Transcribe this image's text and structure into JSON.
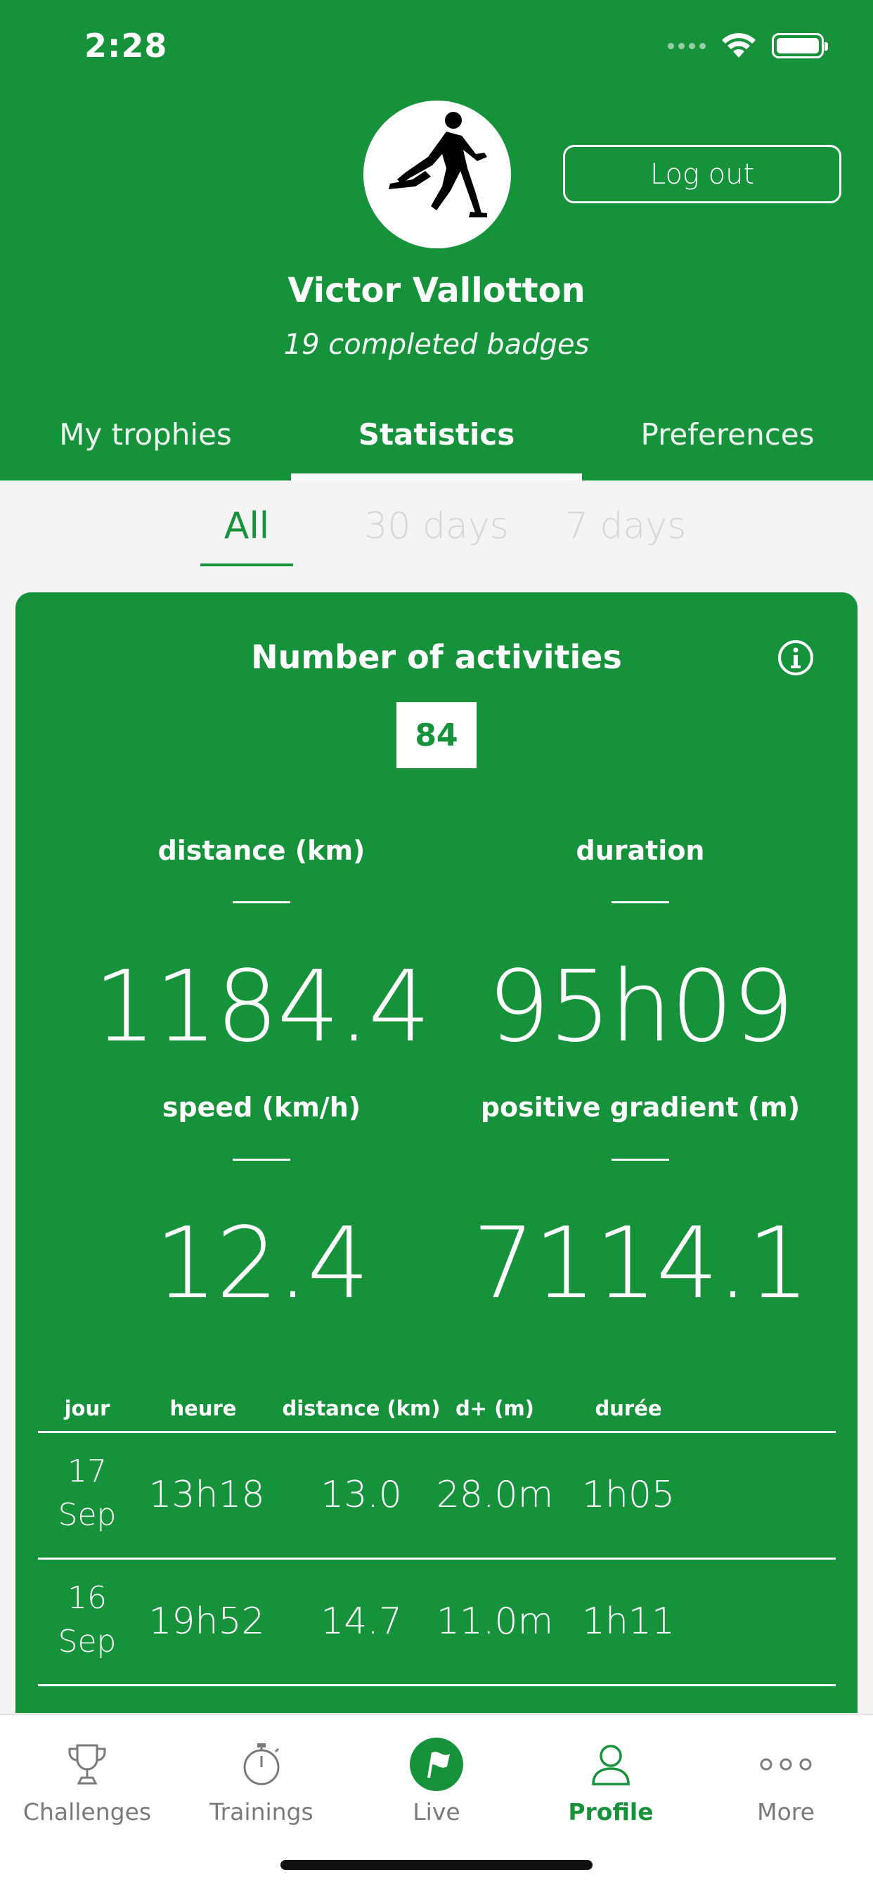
{
  "status_bar": {
    "time": "2:28"
  },
  "profile": {
    "name": "Victor Vallotton",
    "badges_text": "19 completed badges",
    "logout_label": "Log out"
  },
  "tabs": [
    {
      "label": "My trophies",
      "active": false
    },
    {
      "label": "Statistics",
      "active": true
    },
    {
      "label": "Preferences",
      "active": false
    }
  ],
  "period_filter": [
    {
      "label": "All",
      "active": true
    },
    {
      "label": "30 days",
      "active": false
    },
    {
      "label": "7 days",
      "active": false
    }
  ],
  "stats": {
    "title": "Number of activities",
    "activity_count": "84",
    "distance_label": "distance (km)",
    "distance_value": "1184.4",
    "duration_label": "duration",
    "duration_value": "95h09",
    "speed_label": "speed (km/h)",
    "speed_value": "12.4",
    "gradient_label": "positive gradient (m)",
    "gradient_value": "7114.1"
  },
  "table": {
    "headers": [
      "jour",
      "heure",
      "distance (km)",
      "d+ (m)",
      "durée"
    ],
    "rows": [
      {
        "day": "17",
        "month": "Sep",
        "time": "13h18",
        "distance": "13.0",
        "dplus": "28.0m",
        "duration": "1h05"
      },
      {
        "day": "16",
        "month": "Sep",
        "time": "19h52",
        "distance": "14.7",
        "dplus": "11.0m",
        "duration": "1h11"
      }
    ]
  },
  "bottom_nav": [
    {
      "label": "Challenges",
      "icon": "trophy-icon",
      "active": false
    },
    {
      "label": "Trainings",
      "icon": "stopwatch-icon",
      "active": false
    },
    {
      "label": "Live",
      "icon": "flag-icon",
      "active": false
    },
    {
      "label": "Profile",
      "icon": "person-icon",
      "active": true
    },
    {
      "label": "More",
      "icon": "more-icon",
      "active": false
    }
  ],
  "colors": {
    "primary_green": "#16923b",
    "background": "#f4f4f4",
    "inactive_filter": "#d6d6d6",
    "nav_inactive": "#7a7a7a"
  }
}
